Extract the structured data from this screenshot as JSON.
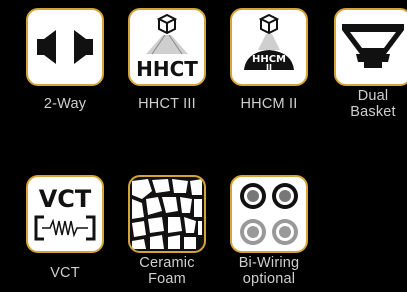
{
  "features": [
    {
      "id": "two-way",
      "icon": "two-way-speaker-icon",
      "label_lines": [
        "2-Way"
      ]
    },
    {
      "id": "hhct-iii",
      "icon": "hhct-icon",
      "icon_text": "HHCT",
      "label_lines": [
        "HHCT III"
      ]
    },
    {
      "id": "hhcm-ii",
      "icon": "hhcm-icon",
      "icon_text_line1": "HHCM",
      "icon_text_line2": "II",
      "label_lines": [
        "HHCM II"
      ]
    },
    {
      "id": "dual-basket",
      "icon": "dual-basket-icon",
      "label_lines": [
        "Dual",
        "Basket"
      ]
    },
    {
      "id": "vct",
      "icon": "vct-icon",
      "icon_text": "VCT",
      "label_lines": [
        "VCT"
      ]
    },
    {
      "id": "ceramic-foam",
      "icon": "ceramic-foam-icon",
      "label_lines": [
        "Ceramic",
        "Foam"
      ]
    },
    {
      "id": "bi-wiring",
      "icon": "bi-wiring-icon",
      "label_lines": [
        "Bi-Wiring",
        "optional"
      ]
    }
  ],
  "colors": {
    "background": "#000000",
    "tile_border": "#d4a437",
    "tile_fill": "#ffffff",
    "icon": "#111111",
    "label": "#cfcfcf"
  }
}
